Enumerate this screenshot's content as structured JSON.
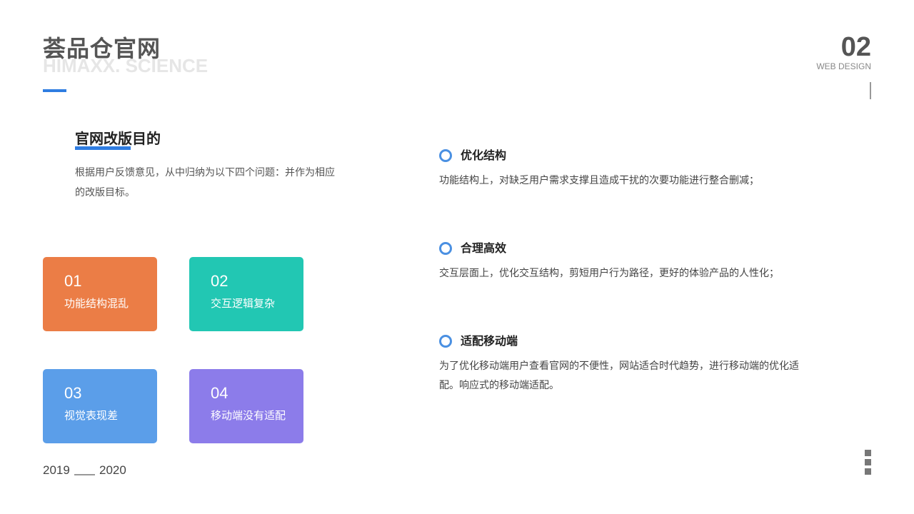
{
  "header": {
    "title": "荟品仓官网",
    "subtitle": "HIMAXX. SCIENCE",
    "page_number": "02",
    "page_label": "WEB DESIGN"
  },
  "intro": {
    "title": "官网改版目的",
    "text": "根据用户反馈意见，从中归纳为以下四个问题：并作为相应的改版目标。"
  },
  "cards": [
    {
      "num": "01",
      "label": "功能结构混乱",
      "color": "#eb7d46"
    },
    {
      "num": "02",
      "label": "交互逻辑复杂",
      "color": "#22c7b3"
    },
    {
      "num": "03",
      "label": "视觉表现差",
      "color": "#5b9ee9"
    },
    {
      "num": "04",
      "label": "移动端没有适配",
      "color": "#8c7cea"
    }
  ],
  "items": [
    {
      "title": "优化结构",
      "desc": "功能结构上，对缺乏用户需求支撑且造成干扰的次要功能进行整合删减；"
    },
    {
      "title": "合理高效",
      "desc": "交互层面上，优化交互结构，剪短用户行为路径，更好的体验产品的人性化；"
    },
    {
      "title": "适配移动端",
      "desc": "为了优化移动端用户查看官网的不便性，网站适合时代趋势，进行移动端的优化适配。响应式的移动端适配。"
    }
  ],
  "footer": {
    "year_start": "2019",
    "year_end": "2020"
  },
  "colors": {
    "accent": "#2f7de1"
  }
}
